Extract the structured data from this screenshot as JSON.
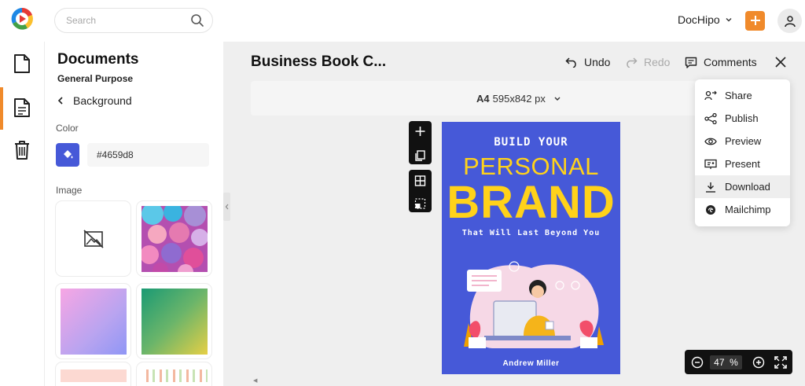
{
  "topbar": {
    "search_placeholder": "Search",
    "account_name": "DocHipo",
    "brand_color": "#f08a2b"
  },
  "rail": {
    "items": [
      {
        "icon": "document-icon",
        "active": false
      },
      {
        "icon": "page-icon",
        "active": true
      },
      {
        "icon": "trash-icon",
        "active": false
      }
    ]
  },
  "panel": {
    "title": "Documents",
    "subtitle": "General Purpose",
    "back_label": "Background",
    "color_label": "Color",
    "color_value": "#4659d8",
    "image_label": "Image"
  },
  "editor": {
    "doc_title": "Business Book C...",
    "undo_label": "Undo",
    "redo_label": "Redo",
    "comments_label": "Comments",
    "page_size_name": "A4",
    "page_size_dims": "595x842 px"
  },
  "cover": {
    "line1": "BUILD YOUR",
    "line2": "PERSONAL",
    "line3": "BRAND",
    "line4": "That Will Last Beyond You",
    "author": "Andrew Miller",
    "background": "#4659d8",
    "accent": "#ffd21a"
  },
  "menu": {
    "items": [
      {
        "label": "Share",
        "icon": "share-people-icon"
      },
      {
        "label": "Publish",
        "icon": "publish-icon"
      },
      {
        "label": "Preview",
        "icon": "eye-icon"
      },
      {
        "label": "Present",
        "icon": "present-icon"
      },
      {
        "label": "Download",
        "icon": "download-icon"
      },
      {
        "label": "Mailchimp",
        "icon": "mailchimp-icon"
      }
    ]
  },
  "zoom": {
    "value": "47",
    "unit": "%"
  }
}
